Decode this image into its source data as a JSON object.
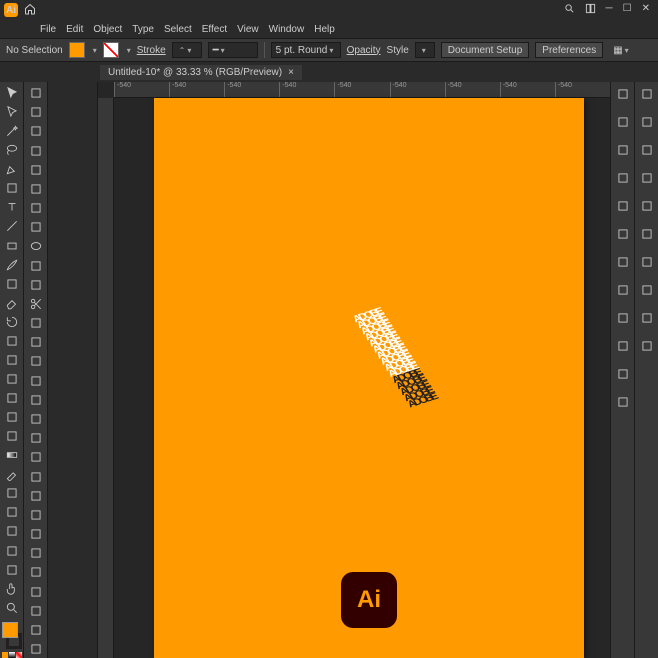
{
  "app": {
    "shortname": "Ai"
  },
  "menus": [
    "File",
    "Edit",
    "Object",
    "Type",
    "Select",
    "Effect",
    "View",
    "Window",
    "Help"
  ],
  "controlbar": {
    "selection_label": "No Selection",
    "stroke_label": "Stroke",
    "stroke_width": "",
    "stroke_profile": "5 pt. Round",
    "opacity_label": "Opacity",
    "style_label": "Style",
    "doc_setup": "Document Setup",
    "prefs": "Preferences"
  },
  "document": {
    "tab_label": "Untitled-10* @ 33.33 % (RGB/Preview)",
    "close_glyph": "×"
  },
  "ruler_ticks": [
    "-540",
    "-540",
    "-540",
    "-540",
    "-540",
    "-540",
    "-540",
    "-540",
    "-540"
  ],
  "colors": {
    "accent": "#ff9a00",
    "artboard": "#ff9a00",
    "badge_bg": "#330000"
  },
  "artwork": {
    "text": "ADOBE",
    "badge_text": "Ai"
  },
  "tools_left_a": [
    "selection",
    "direct-selection",
    "magic-wand",
    "lasso",
    "pen",
    "curvature",
    "type",
    "line",
    "rectangle",
    "paintbrush",
    "shaper",
    "eraser",
    "rotate",
    "scale",
    "width",
    "free-transform",
    "shape-builder",
    "perspective",
    "mesh",
    "gradient",
    "eyedropper",
    "blend",
    "symbol-sprayer",
    "column-graph",
    "artboard",
    "slice",
    "hand",
    "zoom"
  ],
  "tools_left_b": [
    "arrow",
    "group-select",
    "wand2",
    "lasso2",
    "add-anchor",
    "smooth",
    "area-type",
    "arc",
    "ellipse",
    "blob-brush",
    "pencil",
    "scissors",
    "reflect",
    "shear",
    "warp",
    "puppet",
    "live-paint",
    "perspective-select",
    "mesh2",
    "grad2",
    "measure",
    "blend2",
    "symbol2",
    "graph2",
    "artboard2",
    "slice2",
    "hand2",
    "zoom2",
    "extra1",
    "extra2"
  ],
  "panels_right_a": [
    "properties",
    "color",
    "swatches",
    "brushes",
    "symbols",
    "stroke",
    "gradient",
    "transparency",
    "appearance",
    "graphic-styles",
    "layers",
    "libraries"
  ],
  "panels_right_b": [
    "character",
    "paragraph",
    "glyphs",
    "align",
    "pathfinder",
    "transform",
    "links",
    "actions",
    "info",
    "navigator"
  ]
}
